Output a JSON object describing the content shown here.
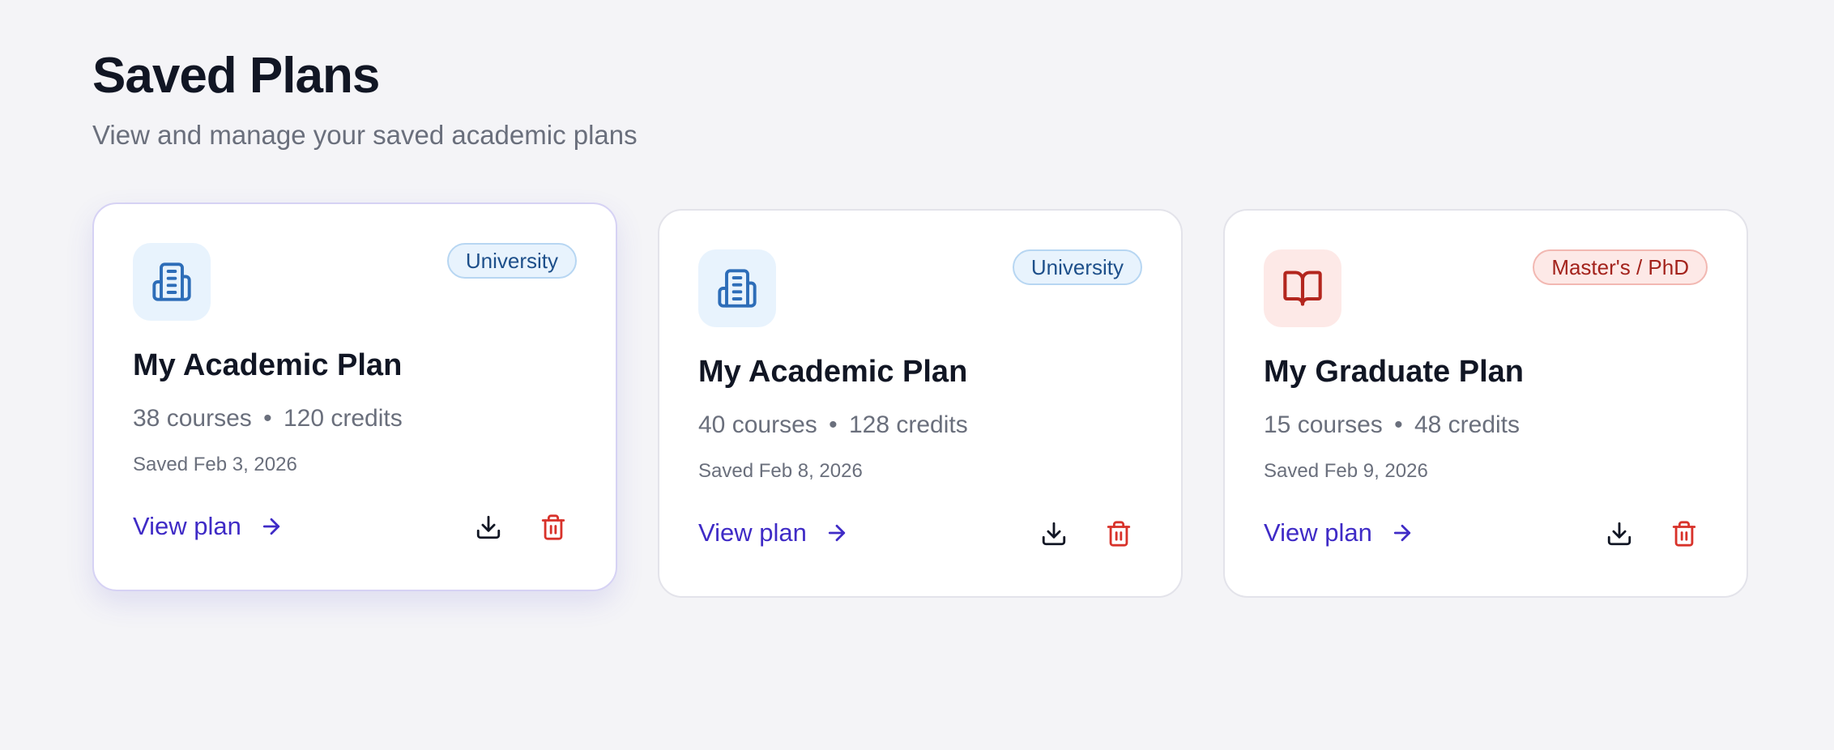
{
  "header": {
    "title": "Saved Plans",
    "subtitle": "View and manage your saved academic plans"
  },
  "colors": {
    "accent": "#3f2bc6",
    "university_badge": "#1d4f8a",
    "masters_badge": "#a3231c",
    "delete": "#d8322a"
  },
  "cards": [
    {
      "icon": "building-icon",
      "badge": "University",
      "title": "My Academic Plan",
      "courses": "38 courses",
      "separator": "•",
      "credits": "120 credits",
      "saved": "Saved Feb 3, 2026",
      "view_label": "View plan"
    },
    {
      "icon": "building-icon",
      "badge": "University",
      "title": "My Academic Plan",
      "courses": "40 courses",
      "separator": "•",
      "credits": "128 credits",
      "saved": "Saved Feb 8, 2026",
      "view_label": "View plan"
    },
    {
      "icon": "book-icon",
      "badge": "Master's / PhD",
      "title": "My Graduate Plan",
      "courses": "15 courses",
      "separator": "•",
      "credits": "48 credits",
      "saved": "Saved Feb 9, 2026",
      "view_label": "View plan"
    }
  ]
}
